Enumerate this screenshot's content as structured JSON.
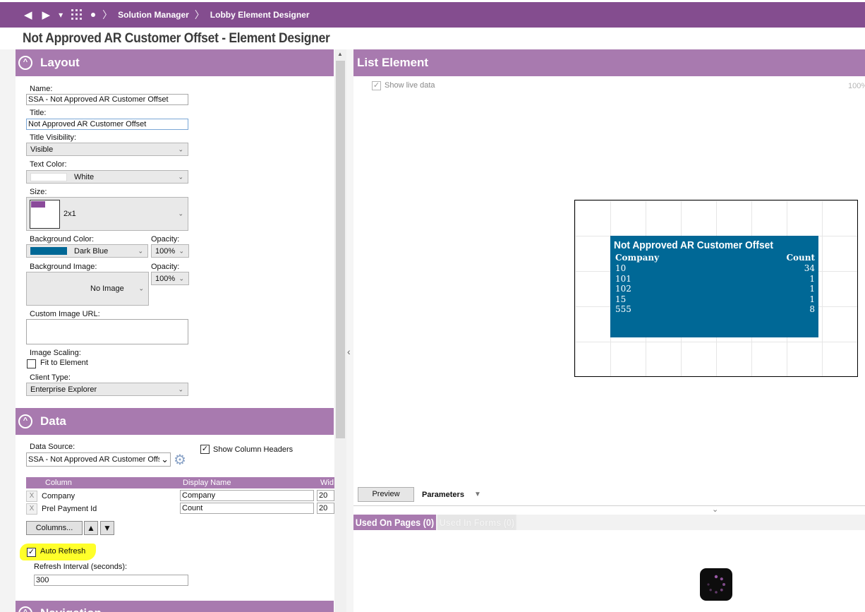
{
  "nav": {
    "back_icon": "◀",
    "forward_icon": "▶",
    "dropdown_icon": "▾",
    "separator": "〉",
    "breadcrumbs": [
      "Solution Manager",
      "Lobby Element Designer"
    ]
  },
  "page_title": "Not Approved AR Customer Offset - Element Designer",
  "layout": {
    "section_title": "Layout",
    "collapse_icon": "^",
    "name_label": "Name:",
    "name_value": "SSA - Not Approved AR Customer Offset",
    "title_label": "Title:",
    "title_value": "Not Approved AR Customer Offset",
    "title_visibility_label": "Title Visibility:",
    "title_visibility_value": "Visible",
    "text_color_label": "Text Color:",
    "text_color_value": "White",
    "text_color_swatch": "#ffffff",
    "size_label": "Size:",
    "size_value": "2x1",
    "size_swatch": "#8a4a9a",
    "bg_color_label": "Background Color:",
    "bg_color_value": "Dark Blue",
    "bg_color_swatch": "#006896",
    "opacity_label": "Opacity:",
    "opacity_value": "100%",
    "bg_image_label": "Background Image:",
    "bg_image_value": "No Image",
    "opacity2_label": "Opacity:",
    "opacity2_value": "100%",
    "custom_image_label": "Custom Image URL:",
    "image_scaling_label": "Image Scaling:",
    "fit_to_element_label": "Fit to Element",
    "client_type_label": "Client Type:",
    "client_type_value": "Enterprise Explorer"
  },
  "data_section": {
    "section_title": "Data",
    "data_source_label": "Data Source:",
    "data_source_value": "SSA - Not Approved AR Customer Offs",
    "show_column_headers_label": "Show Column Headers",
    "columns_table": {
      "headers": [
        "Column",
        "Display Name",
        "Wid"
      ],
      "rows": [
        {
          "column": "Company",
          "display_name": "Company",
          "width": "20"
        },
        {
          "column": "Prel Payment Id",
          "display_name": "Count",
          "width": "20"
        }
      ]
    },
    "columns_button": "Columns...",
    "up_icon": "▲",
    "down_icon": "▼",
    "auto_refresh_label": "Auto Refresh",
    "refresh_interval_label": "Refresh Interval (seconds):",
    "refresh_interval_value": "300",
    "next_section_title": "Navigation"
  },
  "list_element": {
    "title": "List Element",
    "show_live_data_label": "Show live data",
    "zoom": "100%",
    "tile": {
      "title": "Not Approved AR Customer Offset",
      "header_left": "Company",
      "header_right": "Count",
      "rows": [
        {
          "company": "10",
          "count": "34"
        },
        {
          "company": "101",
          "count": "1"
        },
        {
          "company": "102",
          "count": "1"
        },
        {
          "company": "15",
          "count": "1"
        },
        {
          "company": "555",
          "count": "8"
        }
      ]
    },
    "preview_button": "Preview",
    "parameters_label": "Parameters",
    "tabs": [
      "Used On Pages (0)",
      "Used In Forms (0)"
    ]
  },
  "colors": {
    "brand_purple": "#844d8f",
    "section_purple": "#a87aaf",
    "tile_blue": "#006896"
  }
}
